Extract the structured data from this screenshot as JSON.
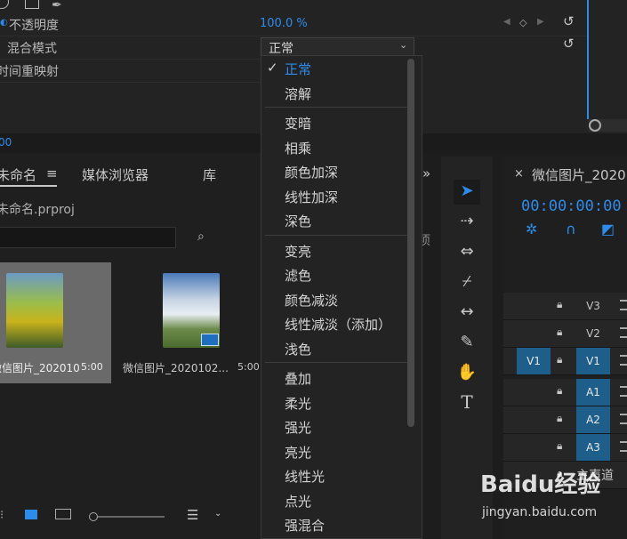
{
  "effects": {
    "opacity_label": "不透明度",
    "opacity_value": "100.0 %",
    "blend_label": "混合模式",
    "time_remap_label": "时间重映射",
    "blend_value": "正常",
    "time_readout": "00"
  },
  "blend_menu": {
    "groups": [
      [
        "正常",
        "溶解"
      ],
      [
        "变暗",
        "相乘",
        "颜色加深",
        "线性加深",
        "深色"
      ],
      [
        "变亮",
        "滤色",
        "颜色减淡",
        "线性减淡（添加）",
        "浅色"
      ],
      [
        "叠加",
        "柔光",
        "强光",
        "亮光",
        "线性光",
        "点光",
        "强混合"
      ]
    ],
    "selected": "正常"
  },
  "project": {
    "tab_name": "未命名",
    "tab_media": "媒体浏览器",
    "tab_lib": "库",
    "file": "未命名.prproj",
    "items": [
      {
        "name": "微信图片_2020102...",
        "duration": "5:00"
      },
      {
        "name": "微信图片_2020102...",
        "duration": "5:00"
      }
    ],
    "partial_text": "项"
  },
  "timeline": {
    "title": "微信图片_2020",
    "timecode": "00:00:00:00",
    "tracks": [
      "V3",
      "V2",
      "V1",
      "A1",
      "A2",
      "A3"
    ],
    "source_v1": "V1",
    "master": "主声道"
  },
  "watermark": {
    "brand": "Baidu经验",
    "url": "jingyan.baidu.com"
  },
  "colors": {
    "accent": "#2d8ceb",
    "selected_track": "#1d5f8a"
  }
}
